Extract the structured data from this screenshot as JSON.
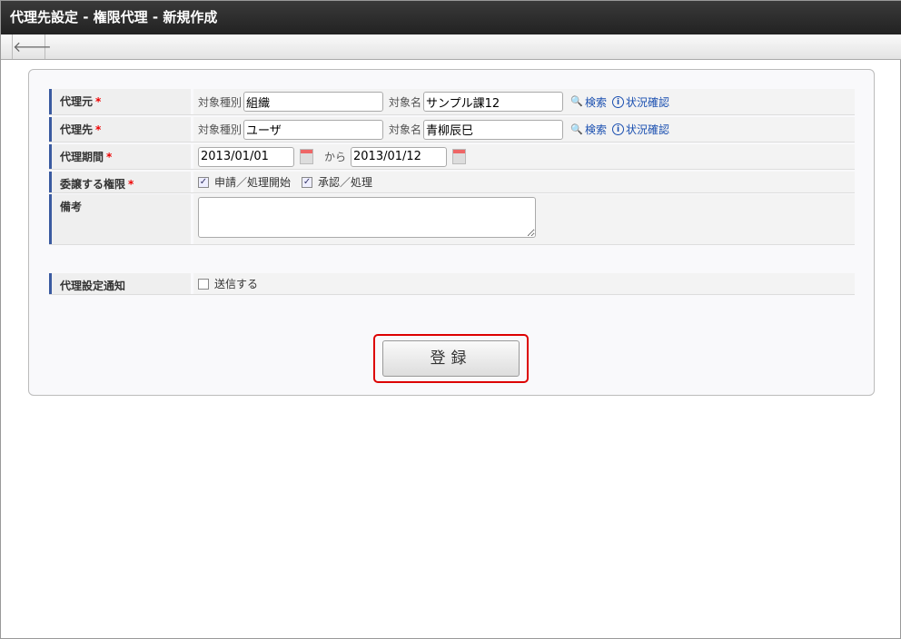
{
  "title": "代理先設定 - 権限代理 - 新規作成",
  "toolbar": {
    "back": "🡐"
  },
  "form": {
    "required_mark": "*",
    "source": {
      "label": "代理元",
      "type_caption": "対象種別",
      "type_value": "組織",
      "name_caption": "対象名",
      "name_value": "サンプル課12",
      "search": "検索",
      "status": "状況確認"
    },
    "target": {
      "label": "代理先",
      "type_caption": "対象種別",
      "type_value": "ユーザ",
      "name_caption": "対象名",
      "name_value": "青柳辰巳",
      "search": "検索",
      "status": "状況確認"
    },
    "period": {
      "label": "代理期間",
      "from": "2013/01/01",
      "sep": "から",
      "to": "2013/01/12"
    },
    "authority": {
      "label": "委譲する権限",
      "opt1": "申請／処理開始",
      "opt2": "承認／処理"
    },
    "remarks": {
      "label": "備考",
      "value": ""
    },
    "notify": {
      "label": "代理設定通知",
      "opt": "送信する"
    }
  },
  "register": "登録"
}
